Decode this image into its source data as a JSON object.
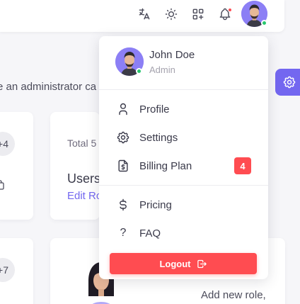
{
  "top_bar": {
    "icons": [
      "translate-icon",
      "sun-icon",
      "grid-plus-icon",
      "bell-icon"
    ],
    "notification_dot_color": "#ff4c51"
  },
  "background": {
    "subtitle": "e an administrator ca",
    "cards": [
      {
        "chip": "+4"
      },
      {
        "total": "Total 5",
        "title": "Users",
        "link": "Edit Ro"
      },
      {
        "chip": "+7"
      },
      {
        "action": "Add new role,"
      }
    ]
  },
  "user_menu": {
    "name": "John Doe",
    "role": "Admin",
    "items": [
      {
        "label": "Profile",
        "icon": "user-icon"
      },
      {
        "label": "Settings",
        "icon": "settings-icon"
      },
      {
        "label": "Billing Plan",
        "icon": "file-dollar-icon",
        "badge": "4"
      },
      {
        "label": "Pricing",
        "icon": "dollar-icon"
      },
      {
        "label": "FAQ",
        "icon": "question-icon",
        "glyph": "?"
      }
    ],
    "logout_label": "Logout"
  },
  "colors": {
    "accent": "#7367f0",
    "danger": "#ff4c51",
    "success": "#28c76f",
    "link": "#7367f0"
  }
}
